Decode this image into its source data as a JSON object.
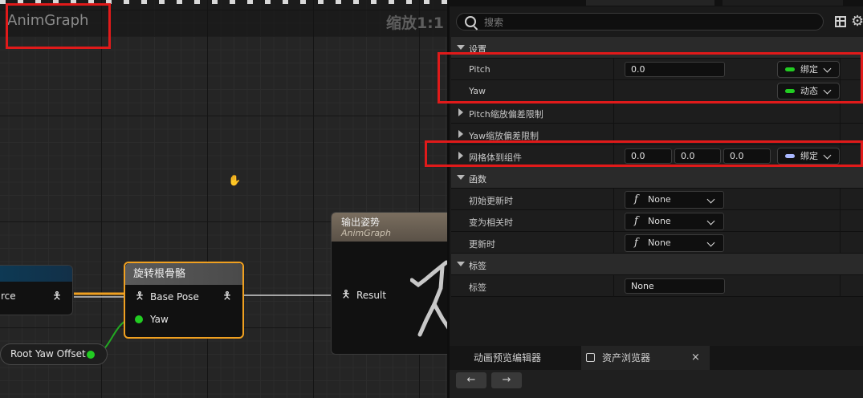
{
  "graph": {
    "title": "AnimGraph",
    "zoom": "缩放1:1"
  },
  "nodes": {
    "source_fragment": {
      "pin_label": "rce"
    },
    "rotate_root_bone": {
      "title": "旋转根骨骼",
      "pin_base_pose": "Base Pose",
      "pin_yaw": "Yaw"
    },
    "root_yaw_offset": {
      "label": "Root Yaw Offset"
    },
    "output_pose": {
      "title": "输出姿势",
      "subtitle": "AnimGraph",
      "pin_result": "Result"
    }
  },
  "details": {
    "search_placeholder": "搜索",
    "sections": {
      "settings": "设置",
      "functions": "函数",
      "tags": "标签"
    },
    "rows": {
      "pitch": {
        "label": "Pitch",
        "value": "0.0",
        "binding": "绑定"
      },
      "yaw": {
        "label": "Yaw",
        "binding": "动态"
      },
      "pitch_scale_bias": {
        "label": "Pitch缩放偏差限制"
      },
      "yaw_scale_bias": {
        "label": "Yaw缩放偏差限制"
      },
      "mesh_to_component": {
        "label": "网格体到组件",
        "x": "0.0",
        "y": "0.0",
        "z": "0.0",
        "binding": "绑定"
      },
      "initial_update": {
        "label": "初始更新时",
        "value": "None"
      },
      "become_relevant": {
        "label": "变为相关时",
        "value": "None"
      },
      "on_update": {
        "label": "更新时",
        "value": "None"
      },
      "tag": {
        "label": "标签",
        "value": "None"
      }
    }
  },
  "bottom_tabs": {
    "anim_preview": "动画预览编辑器",
    "asset_browser": "资产浏览器",
    "close_glyph": "×"
  },
  "nav": {
    "back": "←",
    "forward": "→"
  },
  "colors": {
    "highlight_red": "#e01a1a",
    "node_selected_border": "#f0a020",
    "bind_green": "#22cc22",
    "bind_blue": "#a9b8ff",
    "exec_wire": "#f0a020",
    "float_wire": "#22aa22"
  }
}
